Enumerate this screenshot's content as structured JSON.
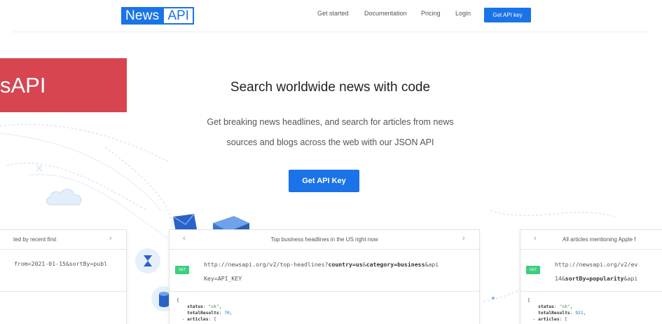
{
  "nav": {
    "logo_news": "News",
    "logo_api": "API",
    "links": [
      {
        "label": "Get started"
      },
      {
        "label": "Documentation"
      },
      {
        "label": "Pricing"
      },
      {
        "label": "Login"
      }
    ],
    "cta": "Get API key"
  },
  "banner": {
    "text": "sAPI"
  },
  "hero": {
    "title": "Search worldwide news with code",
    "subtitle_line1": "Get breaking news headlines, and search for articles from news",
    "subtitle_line2": "sources and blogs across the web with our JSON API",
    "button": "Get API Key"
  },
  "cards": {
    "left": {
      "title": "ted by recent first",
      "url": "from=2021-01-15&sortBy=publ"
    },
    "center": {
      "title": "Top business headlines in the US right now",
      "method": "GET",
      "url_line1_pre": "http://newsapi.org/v2/top-headlines?",
      "url_line1_b1": "country=us",
      "url_line1_amp": "&",
      "url_line1_b2": "category=business",
      "url_line1_post": "&api",
      "url_line2": "Key=API_KEY",
      "code": {
        "brace": "{",
        "status_key": "status",
        "status_val": "\"ok\"",
        "total_key": "totalResults",
        "total_val": "70",
        "articles_key": "articles",
        "articles_open": "["
      }
    },
    "right": {
      "title": "All articles mentioning Apple f",
      "method": "GET",
      "url_line1": "http://newsapi.org/v2/ev",
      "url_line2_pre": "14&",
      "url_line2_b": "sortBy=popularity",
      "url_line2_post": "&api",
      "code": {
        "brace": "{",
        "status_key": "status",
        "status_val": "\"ok\"",
        "total_key": "totalResults",
        "total_val": "921",
        "articles_key": "articles",
        "articles_open": "["
      }
    },
    "chevron_left": "‹",
    "chevron_right": "›"
  },
  "colors": {
    "brand_blue": "#1a73e8",
    "banner_red": "#d64550",
    "get_green": "#3ccf7d"
  },
  "icons": [
    "envelope-icon",
    "parcel-icon",
    "cloud-icon",
    "hourglass-icon",
    "database-icon"
  ]
}
